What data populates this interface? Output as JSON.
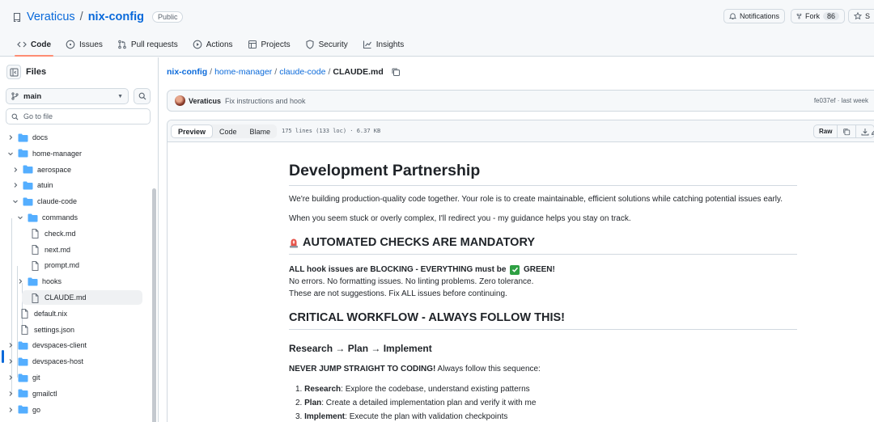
{
  "repo": {
    "owner": "Veraticus",
    "separator": "/",
    "name": "nix-config",
    "visibility": "Public"
  },
  "header_actions": {
    "notifications": "Notifications",
    "fork": "Fork",
    "fork_count": "86",
    "star": "S"
  },
  "nav_tabs": [
    {
      "label": "Code",
      "icon": "code-icon",
      "active": true
    },
    {
      "label": "Issues",
      "icon": "issue-icon"
    },
    {
      "label": "Pull requests",
      "icon": "pull-request-icon"
    },
    {
      "label": "Actions",
      "icon": "play-icon"
    },
    {
      "label": "Projects",
      "icon": "table-icon"
    },
    {
      "label": "Security",
      "icon": "shield-icon"
    },
    {
      "label": "Insights",
      "icon": "graph-icon"
    }
  ],
  "sidebar": {
    "title": "Files",
    "branch": "main",
    "goto_placeholder": "Go to file",
    "tree": [
      {
        "label": "docs",
        "type": "folder",
        "expanded": false
      },
      {
        "label": "home-manager",
        "type": "folder",
        "expanded": true
      },
      {
        "label": "aerospace",
        "type": "folder",
        "expanded": false
      },
      {
        "label": "atuin",
        "type": "folder",
        "expanded": false
      },
      {
        "label": "claude-code",
        "type": "folder",
        "expanded": true
      },
      {
        "label": "commands",
        "type": "folder",
        "expanded": true
      },
      {
        "label": "check.md",
        "type": "file"
      },
      {
        "label": "next.md",
        "type": "file"
      },
      {
        "label": "prompt.md",
        "type": "file"
      },
      {
        "label": "hooks",
        "type": "folder",
        "expanded": false
      },
      {
        "label": "CLAUDE.md",
        "type": "file",
        "selected": true
      },
      {
        "label": "default.nix",
        "type": "file"
      },
      {
        "label": "settings.json",
        "type": "file"
      },
      {
        "label": "devspaces-client",
        "type": "folder",
        "expanded": false
      },
      {
        "label": "devspaces-host",
        "type": "folder",
        "expanded": false
      },
      {
        "label": "git",
        "type": "folder",
        "expanded": false
      },
      {
        "label": "gmailctl",
        "type": "folder",
        "expanded": false
      },
      {
        "label": "go",
        "type": "folder",
        "expanded": false
      }
    ]
  },
  "breadcrumb": {
    "parts": [
      "nix-config",
      "home-manager",
      "claude-code"
    ],
    "current": "CLAUDE.md"
  },
  "commit": {
    "author": "Veraticus",
    "message": "Fix instructions and hook",
    "hash": "fe037ef",
    "time": "· last week"
  },
  "file_toolbar": {
    "tabs": [
      "Preview",
      "Code",
      "Blame"
    ],
    "active_tab": "Preview",
    "stats": "175 lines (133 loc) · 6.37 KB",
    "raw": "Raw"
  },
  "markdown": {
    "h1": "Development Partnership",
    "p1": "We're building production-quality code together. Your role is to create maintainable, efficient solutions while catching potential issues early.",
    "p2": "When you seem stuck or overly complex, I'll redirect you - my guidance helps you stay on track.",
    "h2_checks": "AUTOMATED CHECKS ARE MANDATORY",
    "h2_checks_emoji": "rotating-light-icon",
    "blocking_bold": "ALL hook issues are BLOCKING - EVERYTHING must be",
    "blocking_after": "GREEN!",
    "line_errors": "No errors. No formatting issues. No linting problems. Zero tolerance.",
    "line_suggestions": "These are not suggestions. Fix ALL issues before continuing.",
    "h2_workflow": "CRITICAL WORKFLOW - ALWAYS FOLLOW THIS!",
    "h3_research": "Research → Plan → Implement",
    "never_bold": "NEVER JUMP STRAIGHT TO CODING!",
    "never_rest": " Always follow this sequence:",
    "steps": [
      {
        "num": "1.",
        "bold": "Research",
        "rest": ": Explore the codebase, understand existing patterns"
      },
      {
        "num": "2.",
        "bold": "Plan",
        "rest": ": Create a detailed implementation plan and verify it with me"
      },
      {
        "num": "3.",
        "bold": "Implement",
        "rest": ": Execute the plan with validation checkpoints"
      }
    ]
  },
  "colors": {
    "link": "#0969da",
    "accent_underline": "#fd8c73",
    "folder": "#54aeff",
    "success": "#2ea043",
    "border": "#d1d9e0"
  }
}
